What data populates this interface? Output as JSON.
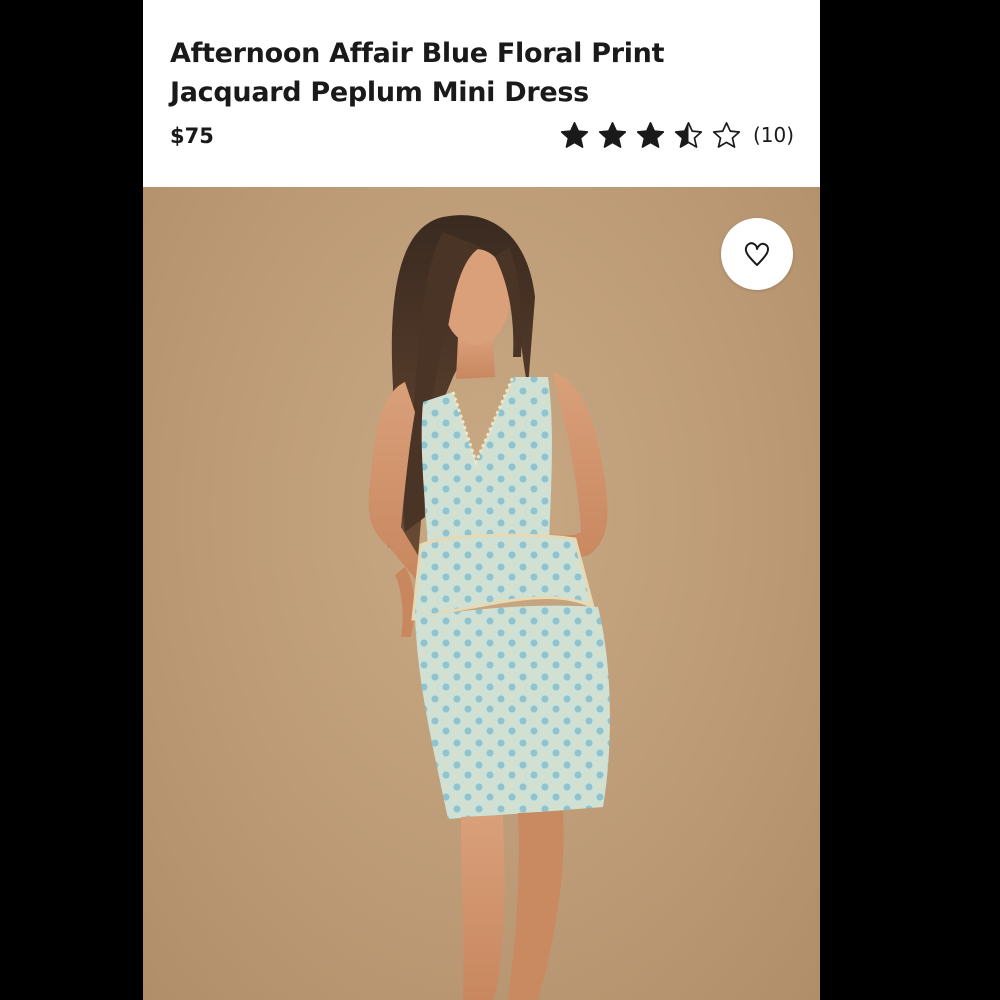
{
  "product": {
    "title": "Afternoon Affair Blue Floral Print Jacquard Peplum Mini Dress",
    "price": "$75",
    "rating": {
      "value": 3.5,
      "max": 5,
      "review_count": "(10)"
    }
  },
  "image": {
    "subject": "product-photo",
    "background_color": "#bc9b76",
    "dress_color": "#b9d5d0"
  },
  "icons": {
    "wishlist": "heart-icon",
    "star": "star-icon"
  },
  "colors": {
    "text": "#1a1a1a",
    "letterbox": "#000000",
    "card": "#ffffff"
  }
}
